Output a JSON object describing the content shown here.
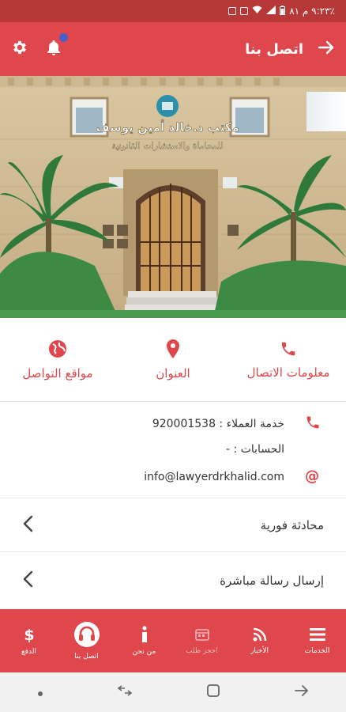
{
  "status_bar": {
    "text": "٩:٢٣ م  ٨١٪"
  },
  "app_bar": {
    "title": "اتصل بنا"
  },
  "hero": {
    "sign_line1": "مكتب د.خالد أمين يوسف",
    "sign_line2": "للمحاماة والاستشارات القانونية"
  },
  "quick_actions": {
    "contact_info": "معلومات الاتصال",
    "address": "العنوان",
    "social": "مواقع التواصل"
  },
  "info": {
    "customer_service": "خدمة العملاء : 920001538",
    "accounts": "الحسابات : -",
    "email": "info@lawyerdrkhalid.com"
  },
  "list": {
    "live_chat": "محادثة فورية",
    "direct_message": "إرسال رسالة مباشرة"
  },
  "bottom_nav": {
    "services": "الخدمات",
    "news": "الأخبار",
    "booking": "احجز طلب",
    "about": "من نحن",
    "contact": "اتصل بنا",
    "payment": "الدفع"
  },
  "colors": {
    "primary": "#e0474c",
    "status_bar": "#b83838",
    "badge": "#4a5fc4"
  }
}
